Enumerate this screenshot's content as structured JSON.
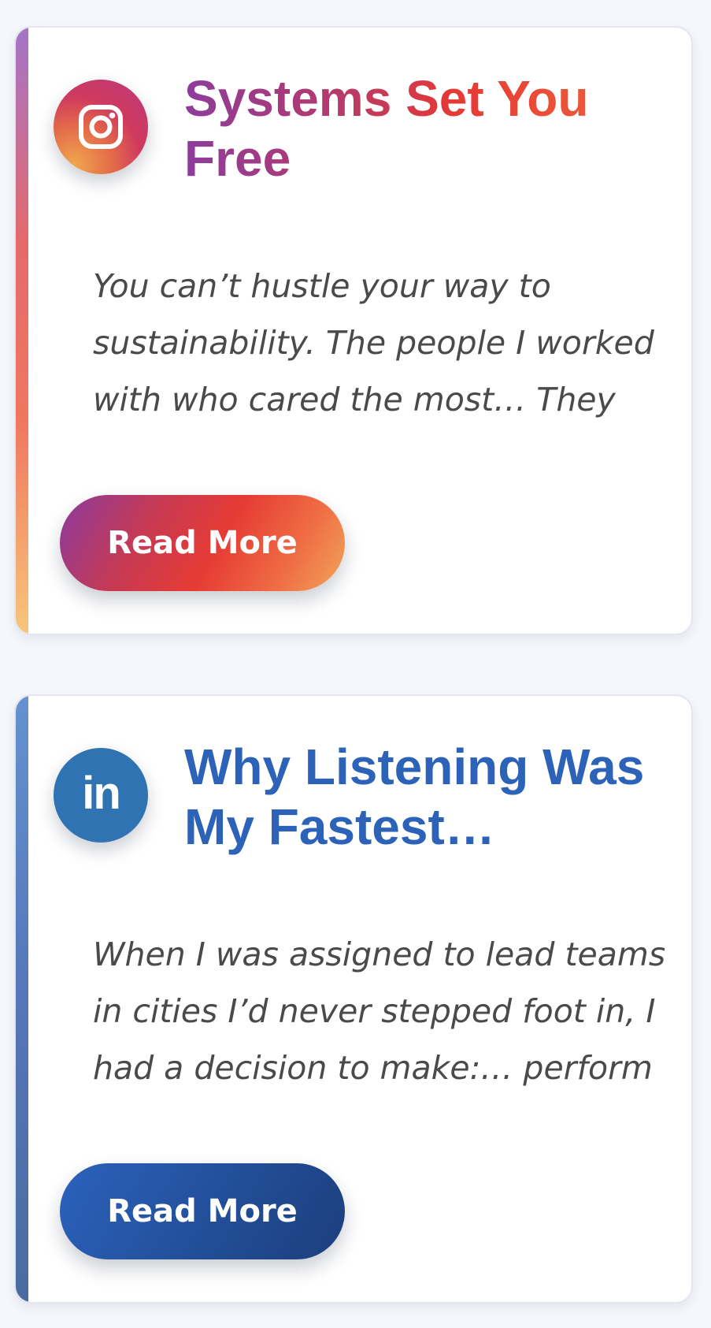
{
  "posts": [
    {
      "platform_icon": "instagram-icon",
      "title": "Systems Set You Free",
      "excerpt": "You can’t hustle your way to sustainability. The people I worked with who cared the most… They burned out the fastest.",
      "button_label": "Read More",
      "colors": {
        "gradient_start": "#8d3c9c",
        "gradient_mid": "#e53935",
        "gradient_end": "#f2a65a"
      }
    },
    {
      "platform_icon": "linkedin-icon",
      "icon_text": "in",
      "title": "Why Listening Was My Fastest…",
      "excerpt": "When I was assigned to lead teams in cities I’d never stepped foot in, I had a decision to make:… perform confidence… or actually",
      "button_label": "Read More",
      "colors": {
        "title": "#2c63b8",
        "icon_bg": "#2f73b3",
        "button_start": "#2b62bd",
        "button_end": "#1c3e7c"
      }
    }
  ]
}
